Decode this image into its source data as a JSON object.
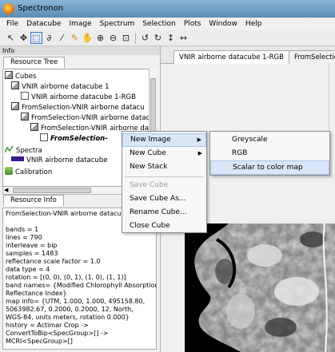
{
  "window": {
    "title": "Spectronon"
  },
  "menubar": [
    "File",
    "Datacube",
    "Image",
    "Spectrum",
    "Selection",
    "Plots",
    "Window",
    "Help"
  ],
  "toolbar": {
    "tools": [
      {
        "icon": "arrow-pointer-icon",
        "glyph": "↖"
      },
      {
        "icon": "move-crosshair-icon",
        "glyph": "✥"
      },
      {
        "icon": "rectangle-select-icon",
        "glyph": "⬚"
      },
      {
        "icon": "lasso-icon",
        "glyph": "∂"
      },
      {
        "icon": "wand-icon",
        "glyph": "⁄"
      },
      {
        "icon": "brush-icon",
        "glyph": "✎"
      },
      {
        "icon": "hand-pan-icon",
        "glyph": "✋"
      },
      {
        "icon": "zoom-in-icon",
        "glyph": "⊕"
      },
      {
        "icon": "zoom-out-icon",
        "glyph": "⊖"
      },
      {
        "icon": "zoom-fit-icon",
        "glyph": "⊡"
      },
      {
        "icon": "rotate-left-icon",
        "glyph": "↺"
      },
      {
        "icon": "rotate-right-icon",
        "glyph": "↻"
      },
      {
        "icon": "flip-vertical-icon",
        "glyph": "↕"
      },
      {
        "icon": "flip-horizontal-icon",
        "glyph": "↔"
      }
    ],
    "active_tool": "rectangle-select-icon"
  },
  "left_panel": {
    "info_header": "Info",
    "resource_tree_tab": "Resource Tree",
    "tree": {
      "cubes": "Cubes",
      "item1": "VNIR airborne datacube 1",
      "item1_child": "VNIR airborne datacube 1-RGB",
      "item2": "FromSelection-VNIR airborne datacu",
      "item3": "FromSelection-VNIR airborne datacu",
      "item4": "FromSelection-VNIR airborne data",
      "item5": "FromSelection-",
      "spectra": "Spectra",
      "spectra_item": "VNIR airborne datacube",
      "calibration": "Calibration"
    },
    "resource_info_tab": "Resource Info",
    "info_lines": [
      "FromSelection-VNIR airborne datacu",
      "",
      "bands = 1",
      "lines = 790",
      "interleave = bip",
      "samples = 1483",
      "reflectance scale factor = 1.0",
      "data type = 4",
      "rotation = [(0, 0), (0, 1), (1, 0), (1, 1)]",
      "band names= {Modified Chlorophyll Absorption",
      "Reflectance Index}",
      "map info= {UTM, 1.000, 1.000, 495158.80,",
      "5063982.67, 0.2000, 0.2000, 12, North,",
      "WGS-84, units   meters, rotation  0.000}",
      "history = Actimar Crop ->",
      "ConvertToBip<SpecGroup>[] ->",
      "MCRI<SpecGroup>[]"
    ]
  },
  "right_panel": {
    "tabs": [
      "VNIR airborne datacube 1-RGB",
      "FromSelectio"
    ]
  },
  "context_menu": {
    "new_image": "New Image",
    "new_cube": "New Cube",
    "new_stack": "New Stack",
    "save_cube": "Save Cube",
    "save_cube_as": "Save Cube As...",
    "rename_cube": "Rename Cube...",
    "close_cube": "Close Cube"
  },
  "submenu": {
    "greyscale": "Greyscale",
    "rgb": "RGB",
    "scalar_to_color_map": "Scalar to color map"
  }
}
